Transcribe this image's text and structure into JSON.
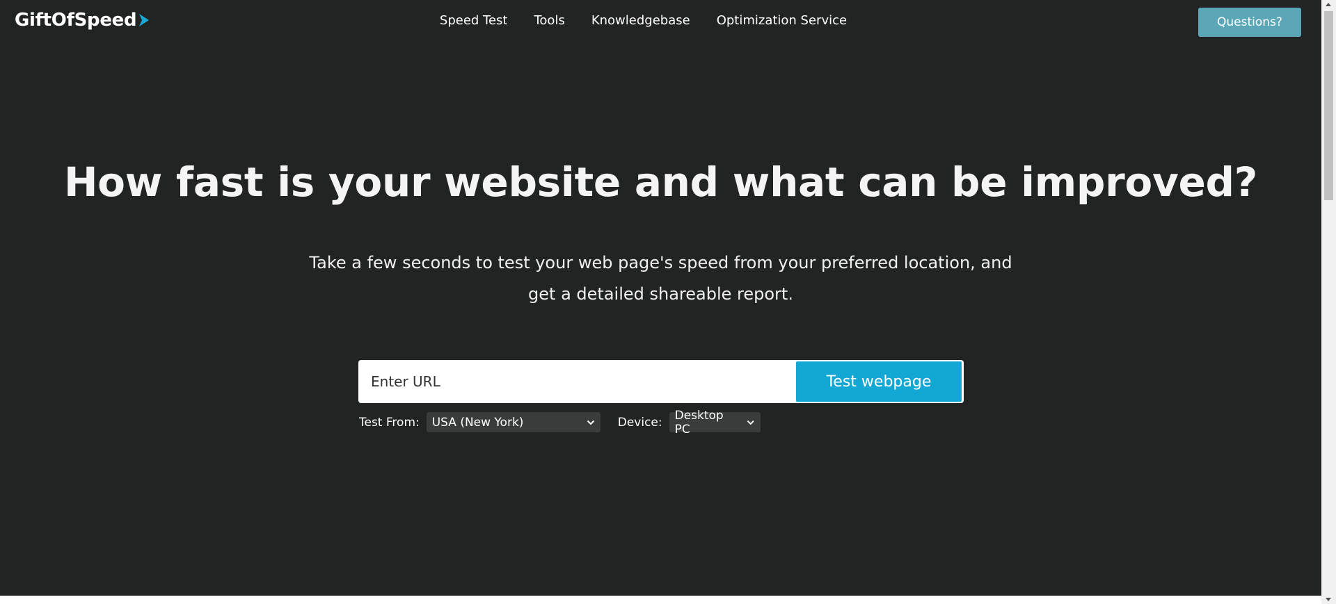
{
  "header": {
    "logo_text": "GiftOfSpeed",
    "nav": [
      {
        "label": "Speed Test"
      },
      {
        "label": "Tools"
      },
      {
        "label": "Knowledgebase"
      },
      {
        "label": "Optimization Service"
      }
    ],
    "questions_label": "Questions?"
  },
  "hero": {
    "title": "How fast is your website and what can be improved?",
    "subtitle_line1": "Take a few seconds to test your web page's speed from your preferred location, and",
    "subtitle_line2": "get a detailed shareable report."
  },
  "form": {
    "url_placeholder": "Enter URL",
    "url_value": "",
    "submit_label": "Test webpage",
    "test_from_label": "Test From:",
    "test_from_value": "USA (New York)",
    "device_label": "Device:",
    "device_value": "Desktop PC"
  },
  "colors": {
    "background": "#222423",
    "accent": "#13a8d4",
    "questions_button": "#5ba7b8"
  },
  "icons": {
    "logo": "play-arrow-icon",
    "select": "chevron-down-icon"
  }
}
